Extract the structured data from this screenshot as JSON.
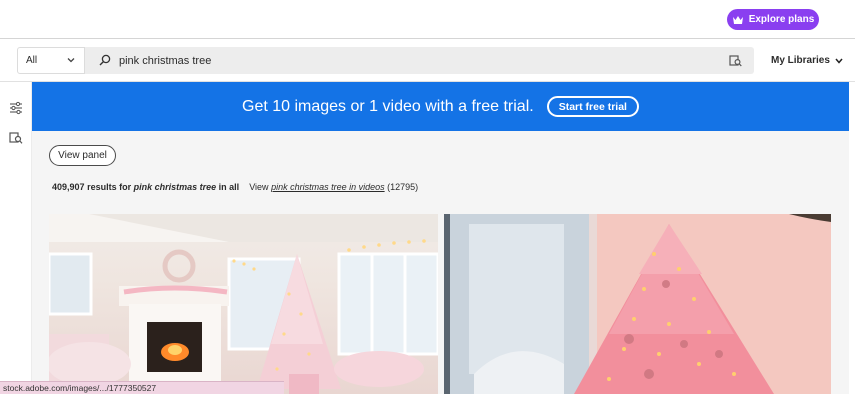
{
  "header": {
    "explore_label": "Explore plans",
    "explore_color": "#8a3ff0",
    "explore_icon": "crown-icon"
  },
  "search": {
    "scope_value": "All",
    "query": "pink christmas tree",
    "libraries_label": "My Libraries",
    "search_icon": "magnifier-icon",
    "visual_search_icon": "visual-search-icon"
  },
  "banner": {
    "text": "Get 10 images or 1 video with a free trial.",
    "cta_label": "Start free trial",
    "color": "#1473e6"
  },
  "filters": {
    "view_panel_label": "View panel"
  },
  "results": {
    "count": "409,907",
    "mid1": "results for",
    "query": "pink christmas tree",
    "mid2": "in all",
    "view_prefix": "View",
    "video_link": "pink christmas tree in videos",
    "video_count": "(12795)"
  },
  "images": [
    {
      "description_icon": "living-room-pink-tree-photo"
    },
    {
      "description_icon": "pink-christmas-tree-window-photo"
    }
  ],
  "status_bar": {
    "url": "stock.adobe.com/images/.../1777350527"
  }
}
